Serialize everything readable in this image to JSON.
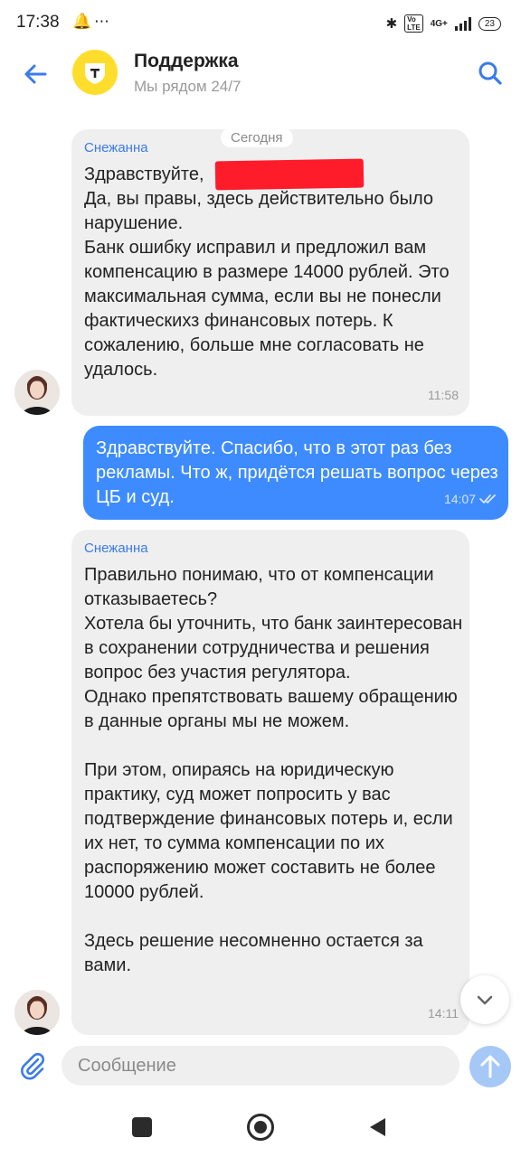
{
  "status": {
    "time": "17:38",
    "network": "4G+",
    "battery": "23"
  },
  "header": {
    "title": "Поддержка",
    "subtitle": "Мы рядом 24/7"
  },
  "date_label": "Сегодня",
  "messages": [
    {
      "sender": "Снежанна",
      "text": "Здравствуйте, \nДа, вы правы, здесь действительно было нарушение.\nБанк ошибку исправил и предложил вам компенсацию в размере 14000 рублей. Это максимальная сумма, если вы не понесли фактическихз финансовых потерь. К сожалению, больше мне согласовать не удалось.",
      "time": "11:58"
    },
    {
      "sender": "",
      "text": "Здравствуйте. Спасибо, что в этот раз без рекламы. Что ж, придётся решать вопрос через ЦБ и суд.",
      "time": "14:07"
    },
    {
      "sender": "Снежанна",
      "text": "Правильно понимаю, что от компенсации отказываетесь?\nХотела бы уточнить, что банк заинтересован в сохранении сотрудничества и решения вопрос без участия регулятора.\nОднако препятствовать вашему обращению в данные органы мы не можем.\n\nПри этом, опираясь на юридическую практику, суд может попросить у вас подтверждение финансовых потерь и, если их нет, то сумма компенсации по их распоряжению может составить не более 10000 рублей.\n\nЗдесь решение несомненно остается за вами.",
      "time": "14:11"
    }
  ],
  "composer": {
    "placeholder": "Сообщение"
  },
  "colors": {
    "accent": "#3d8bff",
    "brand_yellow": "#ffdd2d",
    "incoming_bubble": "#efefef",
    "redaction": "#ff1c2a"
  },
  "icons": [
    "back-arrow-icon",
    "tinkoff-shield-icon",
    "search-icon",
    "attach-icon",
    "send-icon",
    "chevron-down-icon",
    "double-check-icon"
  ]
}
